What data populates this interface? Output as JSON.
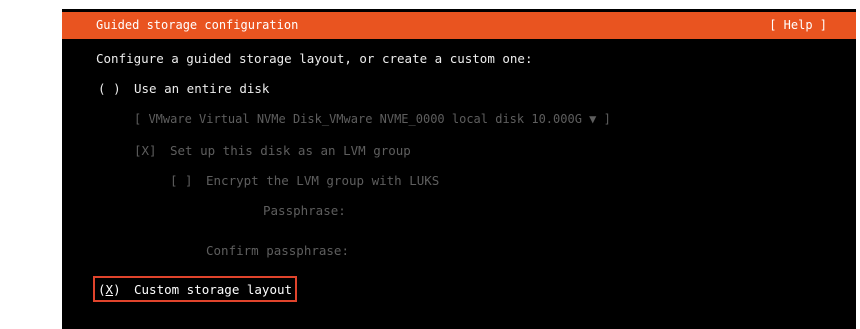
{
  "header": {
    "title": "Guided storage configuration",
    "help": "[ Help ]"
  },
  "intro": "Configure a guided storage layout, or create a custom one:",
  "options": {
    "entire_disk": {
      "radio_open": "( ",
      "radio_close": ")",
      "label": "Use an entire disk"
    },
    "disk_select": {
      "value": "[ VMware Virtual NVMe Disk_VMware NVME_0000 local disk 10.000G ▼ ]"
    },
    "lvm": {
      "checkbox": "[X]",
      "label": "Set up this disk as an LVM group"
    },
    "encrypt": {
      "checkbox": "[ ]",
      "label": "Encrypt the LVM group with LUKS"
    },
    "passphrase": {
      "label": "Passphrase:"
    },
    "confirm_passphrase": {
      "label": "Confirm passphrase:"
    },
    "custom": {
      "radio_open": "(",
      "radio_mark": "X",
      "radio_close": ")",
      "label": "Custom storage layout"
    }
  },
  "colors": {
    "header_bg": "#e95420",
    "terminal_bg": "#000000",
    "highlight_border": "#e0442c",
    "dim_text": "#5e5e5e"
  }
}
